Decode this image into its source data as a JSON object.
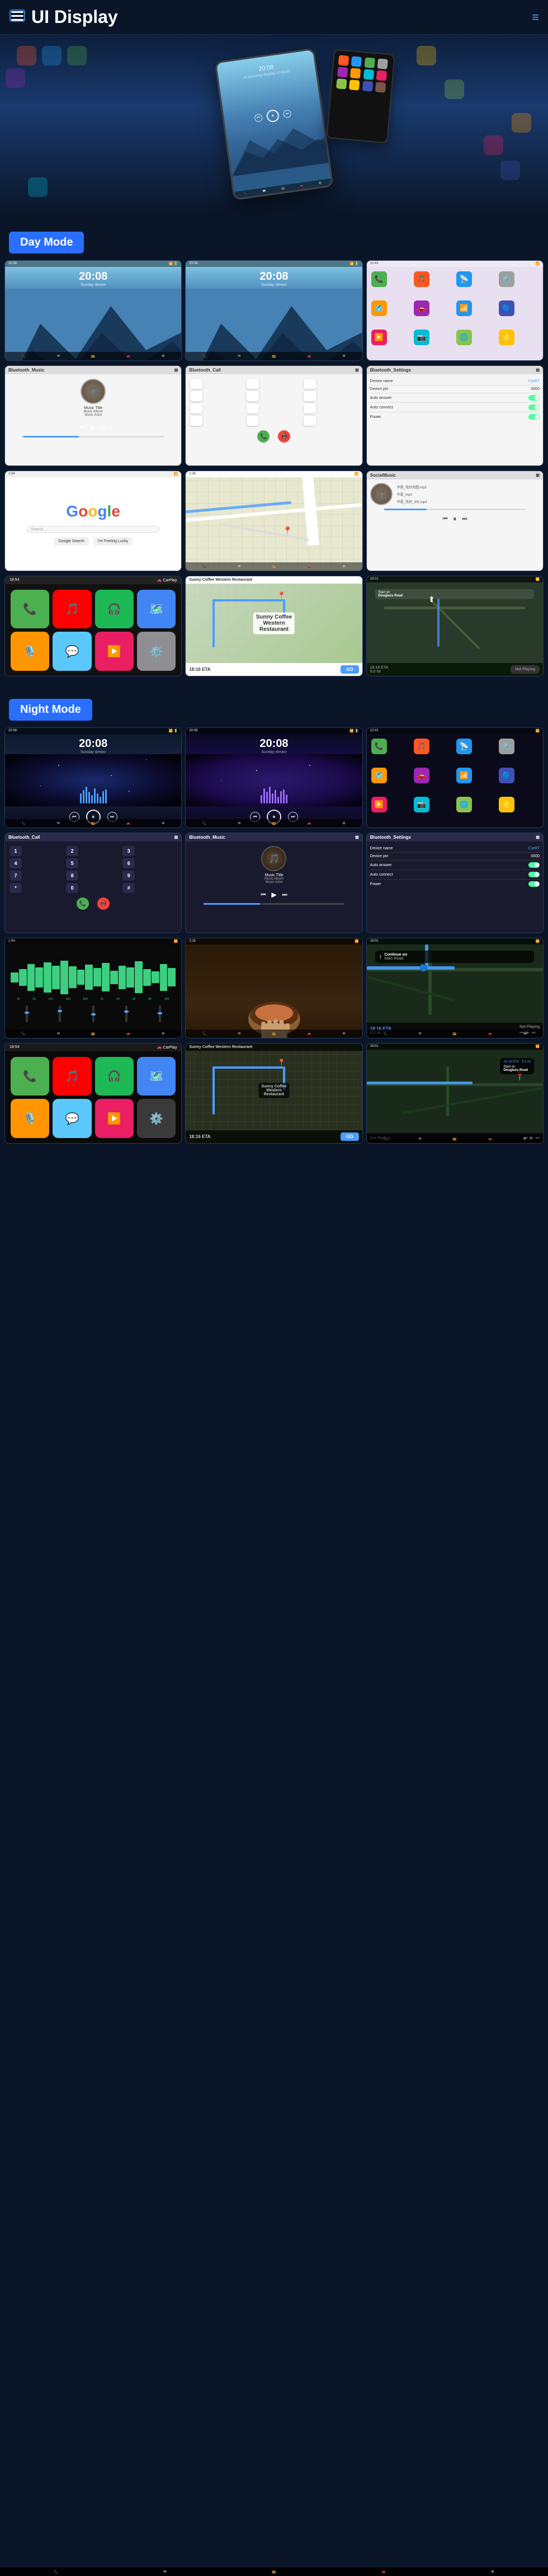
{
  "header": {
    "title": "UI Display",
    "menu_icon": "☰",
    "hamburger_icon": "≡"
  },
  "hero": {
    "time": "20:08",
    "subtitle": "A stunning display of detail"
  },
  "day_mode": {
    "label": "Day Mode",
    "screens": [
      {
        "id": "day-music-1",
        "type": "music",
        "time": "20:08",
        "subtitle": "Sunday dream"
      },
      {
        "id": "day-music-2",
        "type": "music",
        "time": "20:08",
        "subtitle": "Sunday dream"
      },
      {
        "id": "day-apps",
        "type": "apps"
      },
      {
        "id": "day-bluetooth-music",
        "type": "bt-music",
        "header": "Bluetooth_Music",
        "track": "Music Title",
        "album": "Music Album",
        "artist": "Music Artist"
      },
      {
        "id": "day-bluetooth-call",
        "type": "bt-call",
        "header": "Bluetooth_Call"
      },
      {
        "id": "day-bt-settings",
        "type": "bt-settings",
        "header": "Bluetooth_Settings",
        "device_name": "CarBT",
        "device_pin": "0000",
        "auto_answer": true,
        "auto_connect": true,
        "power": true
      },
      {
        "id": "day-google",
        "type": "google"
      },
      {
        "id": "day-map",
        "type": "map"
      },
      {
        "id": "day-local-music",
        "type": "local-music",
        "header": "SocialMusic",
        "tracks": [
          "华夏_花好月圆.mp3",
          "华夏_mp3",
          "华夏_花好_302.mp3"
        ]
      },
      {
        "id": "day-carplay",
        "type": "carplay"
      },
      {
        "id": "day-nav-route",
        "type": "nav-route",
        "restaurant": "Sunny Coffee Western Restaurant",
        "eta": "18:16 ETA",
        "distance": "9.0 mi"
      },
      {
        "id": "day-nav-dark",
        "type": "nav-dark",
        "road": "Douglass Road",
        "start": "Start on Douglass Road",
        "distance": "9.0 mi",
        "eta": "18:16 ETA"
      }
    ]
  },
  "night_mode": {
    "label": "Night Mode",
    "screens": [
      {
        "id": "night-music-1",
        "type": "music-dark",
        "time": "20:08"
      },
      {
        "id": "night-music-2",
        "type": "music-dark",
        "time": "20:08"
      },
      {
        "id": "night-apps",
        "type": "apps-dark"
      },
      {
        "id": "night-bt-call",
        "type": "bt-call-dark",
        "header": "Bluetooth_Call"
      },
      {
        "id": "night-bt-music",
        "type": "bt-music-dark",
        "header": "Bluetooth_Music",
        "track": "Music Title",
        "album": "Music Album",
        "artist": "Music Artist"
      },
      {
        "id": "night-bt-settings",
        "type": "bt-settings-dark",
        "header": "Bluetooth_Settings"
      },
      {
        "id": "night-waveform",
        "type": "waveform-dark"
      },
      {
        "id": "night-photo",
        "type": "photo-dark"
      },
      {
        "id": "night-nav-map",
        "type": "nav-map-dark"
      },
      {
        "id": "night-carplay",
        "type": "carplay-dark"
      },
      {
        "id": "night-nav-route",
        "type": "nav-route-dark",
        "restaurant": "Sunny Coffee Western Restaurant"
      },
      {
        "id": "night-nav-end",
        "type": "nav-end-dark",
        "road": "Douglass Road"
      }
    ]
  },
  "app_colors": {
    "phone": "#4CAF50",
    "messages": "#4CAF50",
    "maps": "#4CAF50",
    "music": "#FF5722",
    "settings": "#9E9E9E",
    "bluetooth": "#2196F3",
    "youtube": "#FF0000",
    "netflix": "#E50914",
    "spotify": "#1DB954",
    "carplay": "#000"
  }
}
